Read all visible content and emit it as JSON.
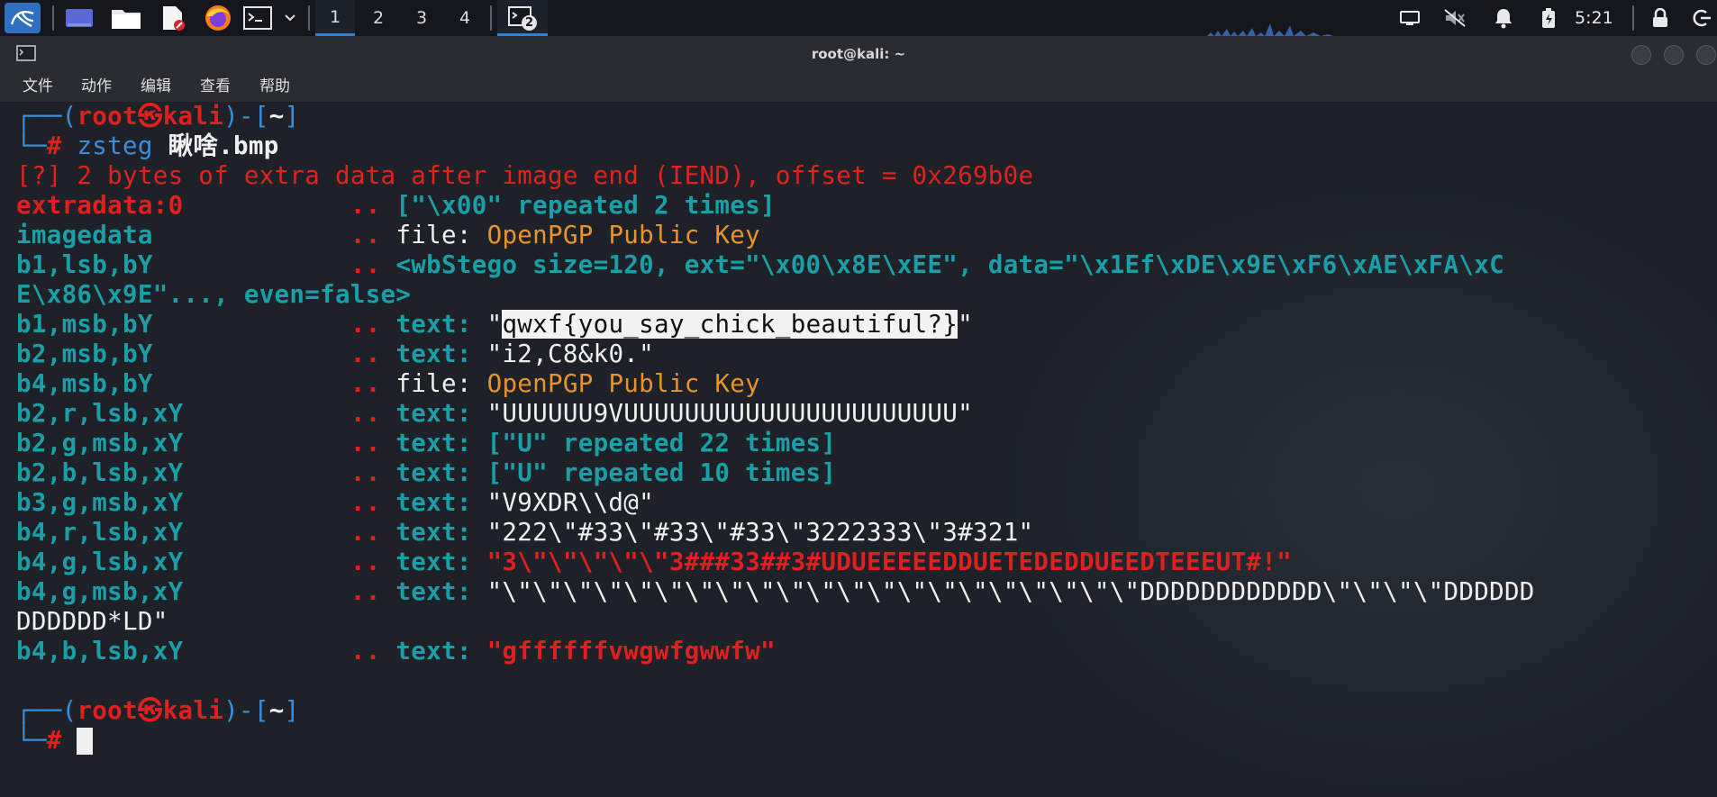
{
  "panel": {
    "workspaces": [
      "1",
      "2",
      "3",
      "4"
    ],
    "active_workspace": "1",
    "clock": "5:21",
    "terminal_badge": "2"
  },
  "window": {
    "title": "root@kali: ~",
    "menu": [
      "文件",
      "动作",
      "编辑",
      "查看",
      "帮助"
    ]
  },
  "terminal": {
    "prompt_user": "root",
    "prompt_host": "kali",
    "prompt_dir": "~",
    "prompt_symbol": "#",
    "command": "zsteg",
    "command_arg": "瞅啥.bmp",
    "warning": "[?] 2 bytes of extra data after image end (IEND), offset = 0x269b0e",
    "rows": [
      {
        "key": "extradata:0",
        "sep": "..",
        "type": "",
        "value": "[\"\\x00\" repeated 2 times]"
      },
      {
        "key": "imagedata",
        "sep": "..",
        "type": "file:",
        "value": "OpenPGP Public Key"
      },
      {
        "key": "b1,lsb,bY",
        "sep": "..",
        "type": "",
        "value": "<wbStego size=120, ext=\"\\x00\\x8E\\xEE\", data=\"\\x1Ef\\xDE\\x9E\\xF6\\xAE\\xFA\\xC",
        "cont": "E\\x86\\x9E\"..., even=false>"
      },
      {
        "key": "b1,msb,bY",
        "sep": "..",
        "type": "text:",
        "q": "\"",
        "value": "qwxf{you_say_chick_beautiful?}",
        "q2": "\""
      },
      {
        "key": "b2,msb,bY",
        "sep": "..",
        "type": "text:",
        "value": "\"i2,C8&k0.\""
      },
      {
        "key": "b4,msb,bY",
        "sep": "..",
        "type": "file:",
        "value": "OpenPGP Public Key"
      },
      {
        "key": "b2,r,lsb,xY",
        "sep": "..",
        "type": "text:",
        "value": "\"UUUUUU9VUUUUUUUUUUUUUUUUUUUUUU\""
      },
      {
        "key": "b2,g,msb,xY",
        "sep": "..",
        "type": "text:",
        "value": "[\"U\" repeated 22 times]"
      },
      {
        "key": "b2,b,lsb,xY",
        "sep": "..",
        "type": "text:",
        "value": "[\"U\" repeated 10 times]"
      },
      {
        "key": "b3,g,msb,xY",
        "sep": "..",
        "type": "text:",
        "value": "\"V9XDR\\\\d@\""
      },
      {
        "key": "b4,r,lsb,xY",
        "sep": "..",
        "type": "text:",
        "value": "\"222\\\"#33\\\"#33\\\"#33\\\"3222333\\\"3#321\""
      },
      {
        "key": "b4,g,lsb,xY",
        "sep": "..",
        "type": "text:",
        "value": "\"3\\\"\\\"\\\"\\\"\\\"3###33##3#UDUEEEEEDDUETEDEDDUEEDTEEEUT#!\""
      },
      {
        "key": "b4,g,msb,xY",
        "sep": "..",
        "type": "text:",
        "value": "\"\\\"\\\"\\\"\\\"\\\"\\\"\\\"\\\"\\\"\\\"\\\"\\\"\\\"\\\"\\\"\\\"\\\"\\\"\\\"\\\"\\\"DDDDDDDDDDDD\\\"\\\"\\\"\\\"DDDDDD",
        "cont": "DDDDDD*LD\""
      },
      {
        "key": "b4,b,lsb,xY",
        "sep": "..",
        "type": "text:",
        "value": "\"gffffffvwgwfgwwfw\""
      }
    ]
  },
  "colors": {
    "prompt_frame": "#3b8edb",
    "prompt_user": "#e0231f",
    "key": "#1a9fa8",
    "file_value": "#e8932c",
    "highlight": "#f2f2f2"
  }
}
